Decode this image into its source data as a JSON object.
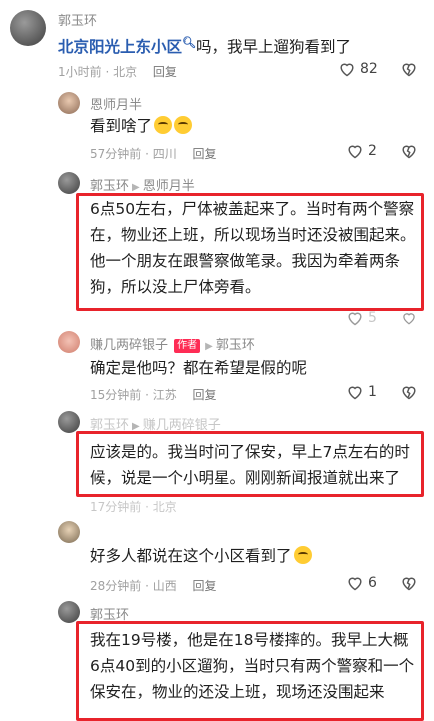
{
  "comments": [
    {
      "user": "郭玉环",
      "location_tag": "北京阳光上东小区",
      "text": "吗，我早上遛狗看到了",
      "time": "1小时前 · 北京",
      "reply_label": "回复",
      "likes": "82"
    },
    {
      "user": "恩师月半",
      "text": "看到啥了",
      "time": "57分钟前 · 四川",
      "reply_label": "回复",
      "likes": "2"
    },
    {
      "user": "郭玉环",
      "reply_to": "恩师月半",
      "text": "6点50左右，尸体被盖起来了。当时有两个警察在，物业还上班，所以现场当时还没被围起来。他一个朋友在跟警察做笔录。我因为牵着两条狗，所以没上尸体旁看。",
      "likes": "5"
    },
    {
      "user": "赚几两碎银子",
      "author_badge": "作者",
      "reply_to": "郭玉环",
      "text": "确定是他吗？都在希望是假的呢",
      "time": "15分钟前 · 江苏",
      "reply_label": "回复",
      "likes": "1"
    },
    {
      "user": "郭玉环",
      "reply_to": "赚几两碎银子",
      "text": "应该是的。我当时问了保安，早上7点左右的时候，说是一个小明星。刚刚新闻报道就出来了",
      "time": "17分钟前 · 北京",
      "reply_label": "回复"
    },
    {
      "user": "",
      "text": "好多人都说在这个小区看到了",
      "time": "28分钟前 · 山西",
      "reply_label": "回复",
      "likes": "6"
    },
    {
      "user": "郭玉环",
      "text": "我在19号楼，他是在18号楼摔的。我早上大概6点40到的小区遛狗，当时只有两个警察和一个保安在，物业的还没上班，现场还没围起来"
    }
  ]
}
